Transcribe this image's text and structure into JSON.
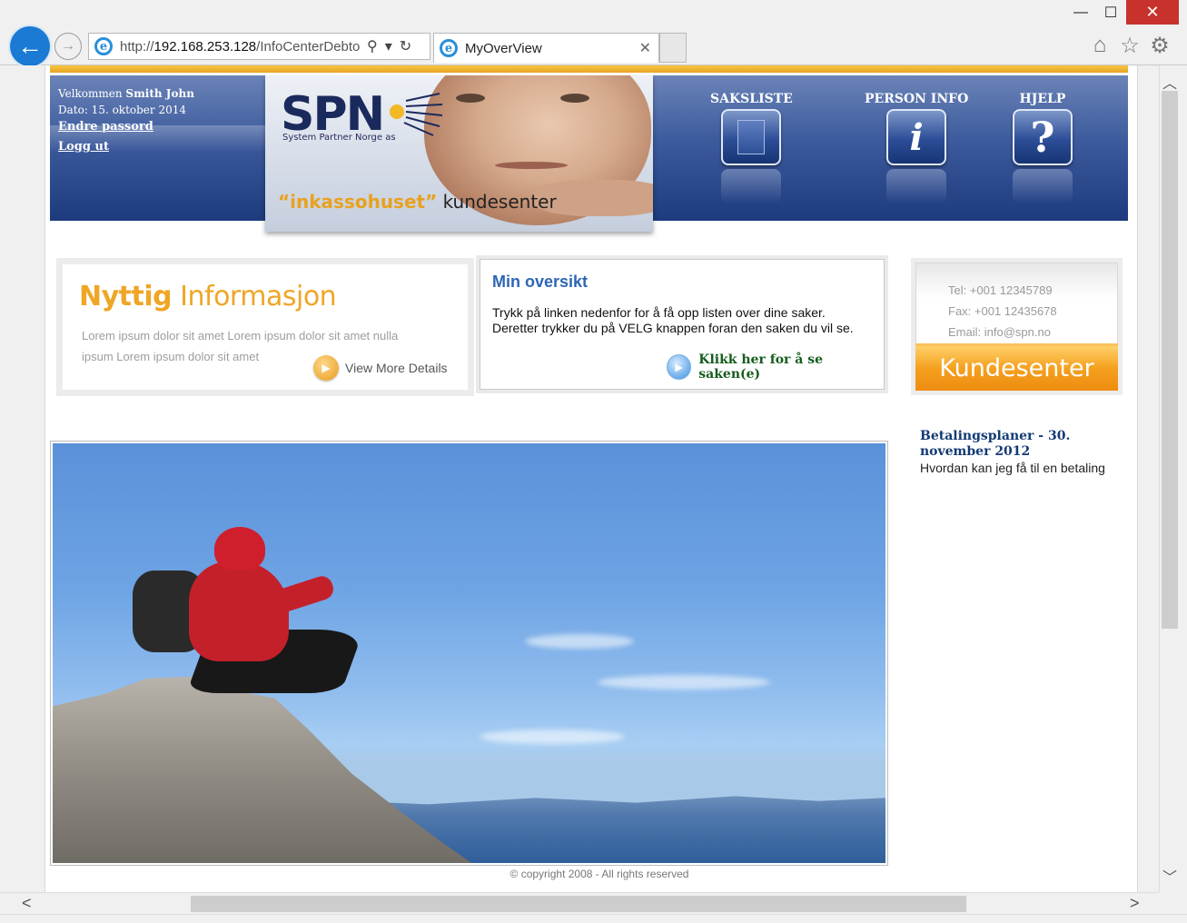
{
  "browser": {
    "address": "http://192.168.253.128/InfoCenterDebto",
    "address_host": "192.168.253.128",
    "address_scheme": "http://",
    "address_path": "/InfoCenterDebto",
    "tab_title": "MyOverView"
  },
  "header": {
    "welcome_prefix": "Velkommen",
    "user_name": "Smith John",
    "date_line": "Dato: 15. oktober 2014",
    "change_password": "Endre passord",
    "logout": "Logg ut",
    "logo_text": "SPN",
    "logo_subtitle": "System Partner Norge as",
    "slogan_quoted": "“inkassohuset”",
    "slogan_rest": "kundesenter",
    "nav": [
      {
        "label": "SAKSLISTE",
        "icon": "document-icon"
      },
      {
        "label": "PERSON INFO",
        "icon": "info-icon"
      },
      {
        "label": "HJELP",
        "icon": "help-icon"
      }
    ]
  },
  "nyttig": {
    "title_bold": "Nyttig",
    "title_rest": "Informasjon",
    "body": "Lorem ipsum dolor sit amet Lorem ipsum dolor sit amet nulla ipsum Lorem ipsum dolor sit amet",
    "more_label": "View More Details"
  },
  "min_oversikt": {
    "title": "Min oversikt",
    "line1": "Trykk på linken nedenfor for å få opp listen over dine saker.",
    "line2": "Deretter trykker du på VELG knappen foran den saken du vil se.",
    "link_label": "Klikk her for å se saken(e)"
  },
  "contact": {
    "tel": "Tel: +001 12345789",
    "fax": "Fax: +001 12435678",
    "email": "Email: info@spn.no",
    "button_label": "Kundesenter"
  },
  "news": {
    "title": "Betalingsplaner - 30. november 2012",
    "body": "Hvordan kan jeg få til en betaling"
  },
  "footer": {
    "copyright": "© copyright 2008 - All rights reserved"
  },
  "colors": {
    "header_blue": "#2c4d97",
    "accent_orange": "#f4a01e",
    "link_blue": "#2e66b5",
    "link_green": "#155c1c",
    "close_red": "#c8322d"
  }
}
